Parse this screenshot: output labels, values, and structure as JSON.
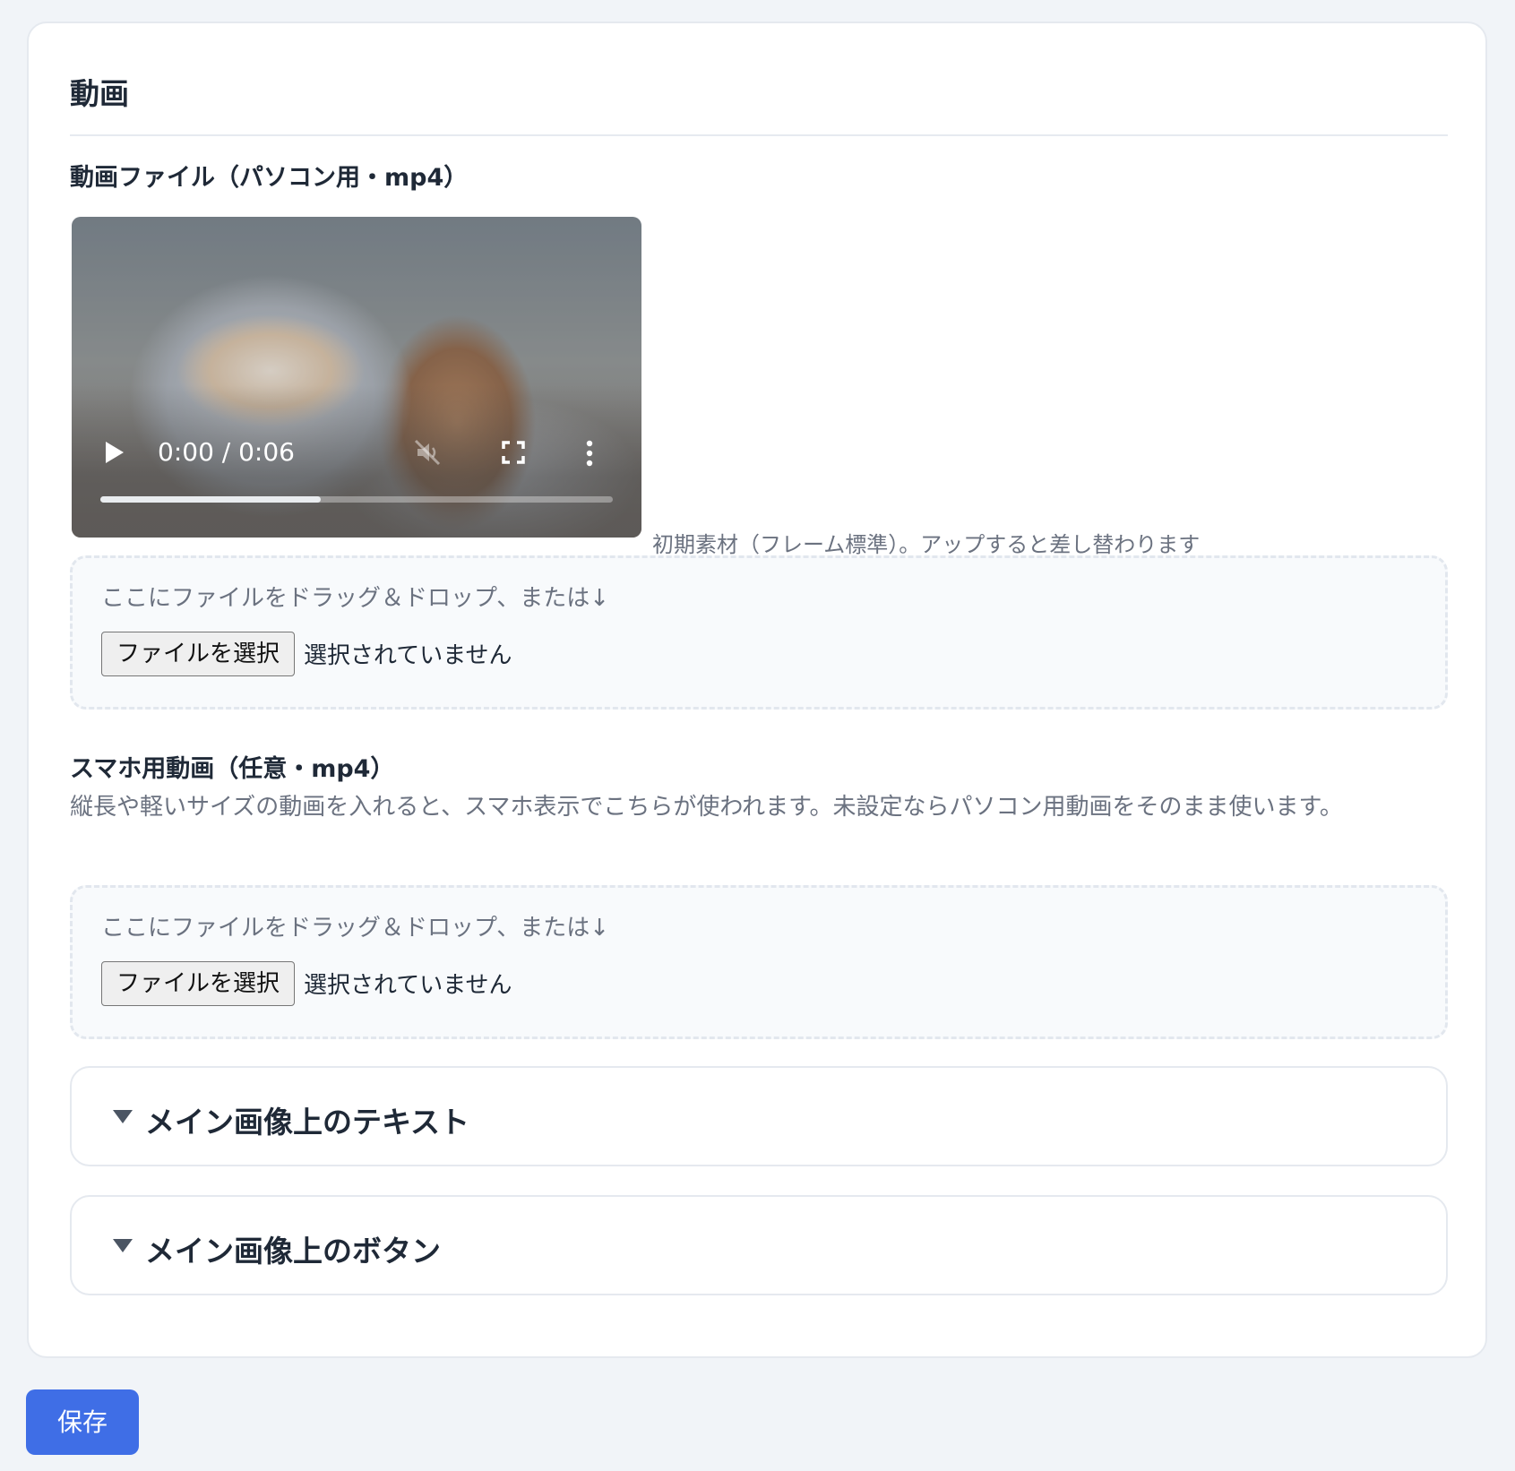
{
  "section": {
    "title": "動画"
  },
  "pc_video": {
    "label": "動画ファイル（パソコン用・mp4）",
    "player": {
      "time": "0:00 / 0:06",
      "progress_fraction": 0.43
    },
    "caption": "初期素材（フレーム標準）。アップすると差し替わります",
    "dropzone": {
      "hint": "ここにファイルをドラッグ＆ドロップ、または↓",
      "button_label": "ファイルを選択",
      "status": "選択されていません"
    }
  },
  "sp_video": {
    "label": "スマホ用動画（任意・mp4）",
    "help": "縦長や軽いサイズの動画を入れると、スマホ表示でこちらが使われます。未設定ならパソコン用動画をそのまま使います。",
    "dropzone": {
      "hint": "ここにファイルをドラッグ＆ドロップ、または↓",
      "button_label": "ファイルを選択",
      "status": "選択されていません"
    }
  },
  "accordions": [
    {
      "title": "メイン画像上のテキスト",
      "icon": "triangle-down-icon"
    },
    {
      "title": "メイン画像上のボタン",
      "icon": "triangle-down-icon"
    }
  ],
  "actions": {
    "save_label": "保存"
  },
  "colors": {
    "primary": "#3f6ee6",
    "page_bg": "#f1f4f8",
    "card_bg": "#ffffff",
    "muted_text": "#6b7280"
  }
}
